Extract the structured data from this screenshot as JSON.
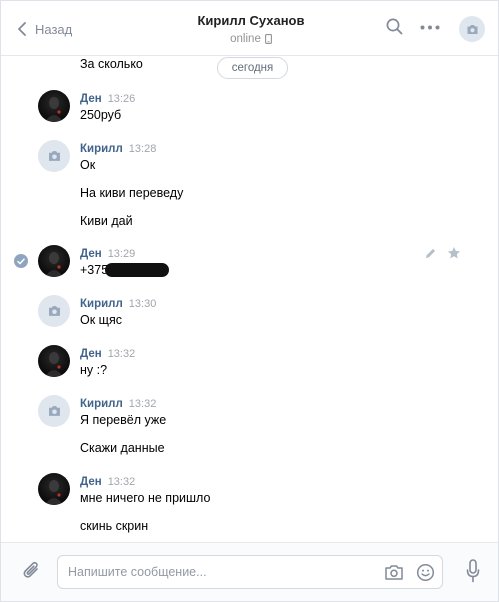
{
  "header": {
    "back_label": "Назад",
    "title": "Кирилл Суханов",
    "status": "online"
  },
  "history": {
    "date_label": "сегодня",
    "messages": [
      {
        "author": "",
        "time": "",
        "lines": [
          "За сколько"
        ]
      },
      {
        "author": "Ден",
        "time": "13:26",
        "lines": [
          "250руб"
        ]
      },
      {
        "author": "Кирилл",
        "time": "13:28",
        "lines": [
          "Ок",
          "На киви переведу",
          "Киви дай"
        ]
      },
      {
        "author": "Ден",
        "time": "13:29",
        "lines": [
          "+375"
        ]
      },
      {
        "author": "Кирилл",
        "time": "13:30",
        "lines": [
          "Ок щяс"
        ]
      },
      {
        "author": "Ден",
        "time": "13:32",
        "lines": [
          "ну :?"
        ]
      },
      {
        "author": "Кирилл",
        "time": "13:32",
        "lines": [
          "Я перевёл уже",
          "Скажи данные"
        ]
      },
      {
        "author": "Ден",
        "time": "13:32",
        "lines": [
          "мне ничего не пришло",
          "скинь скрин"
        ]
      }
    ]
  },
  "composer": {
    "placeholder": "Напишите сообщение..."
  },
  "icons": {
    "back": "chevron-left-icon",
    "search": "search-icon",
    "more": "more-dots-icon",
    "phone": "phone-icon",
    "camera": "camera-icon",
    "attach": "paperclip-icon",
    "emoji": "smile-icon",
    "mic": "microphone-icon",
    "edit": "pencil-icon",
    "star": "star-icon",
    "check": "check-icon"
  },
  "colors": {
    "author": "#42648b",
    "time": "#a0a6ad",
    "icon": "#828a99",
    "selected_check": "#8ea4bf"
  }
}
